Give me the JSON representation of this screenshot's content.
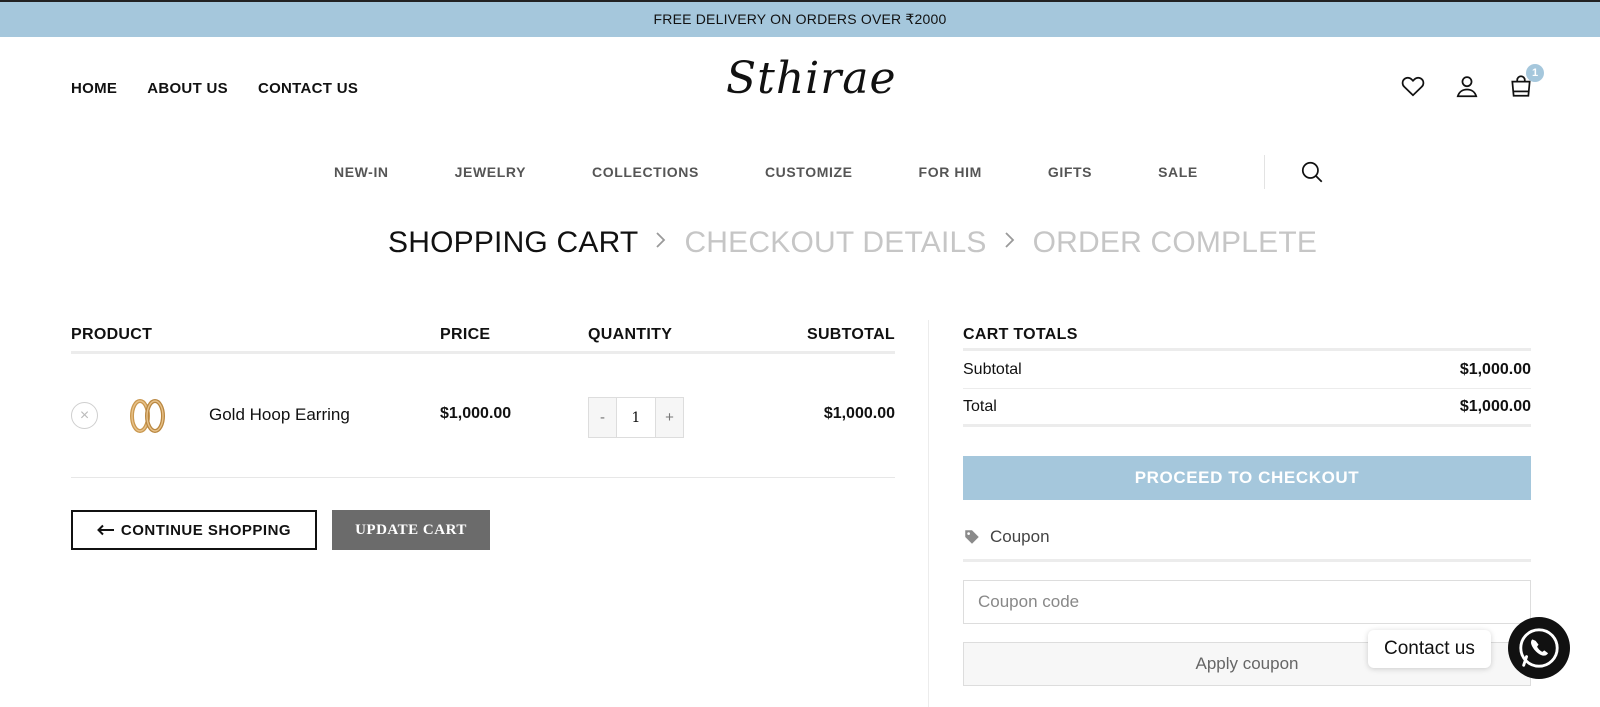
{
  "topbar": {
    "text": "FREE DELIVERY ON ORDERS OVER ₹2000"
  },
  "header": {
    "left_nav": [
      "HOME",
      "ABOUT US",
      "CONTACT US"
    ],
    "logo_text": "Sthirae",
    "cart_count": "1"
  },
  "main_nav": [
    "NEW-IN",
    "JEWELRY",
    "COLLECTIONS",
    "CUSTOMIZE",
    "FOR HIM",
    "GIFTS",
    "SALE"
  ],
  "steps": {
    "step1": "SHOPPING CART",
    "step2": "CHECKOUT DETAILS",
    "step3": "ORDER COMPLETE"
  },
  "cart": {
    "headers": {
      "product": "PRODUCT",
      "price": "PRICE",
      "quantity": "QUANTITY",
      "subtotal": "SUBTOTAL"
    },
    "items": [
      {
        "name": "Gold Hoop Earring",
        "price": "$1,000.00",
        "qty": "1",
        "subtotal": "$1,000.00"
      }
    ],
    "remove_glyph": "×",
    "qty_minus": "-",
    "qty_plus": "+",
    "continue_label": "CONTINUE SHOPPING",
    "update_label": "UPDATE CART"
  },
  "totals": {
    "title": "CART TOTALS",
    "subtotal_label": "Subtotal",
    "subtotal_value": "$1,000.00",
    "total_label": "Total",
    "total_value": "$1,000.00",
    "checkout_label": "PROCEED TO CHECKOUT",
    "coupon_label": "Coupon",
    "coupon_placeholder": "Coupon code",
    "apply_label": "Apply coupon"
  },
  "contact": {
    "label": "Contact us"
  },
  "colors": {
    "accent": "#a5c7dc",
    "update_button": "#6b6b6b"
  }
}
